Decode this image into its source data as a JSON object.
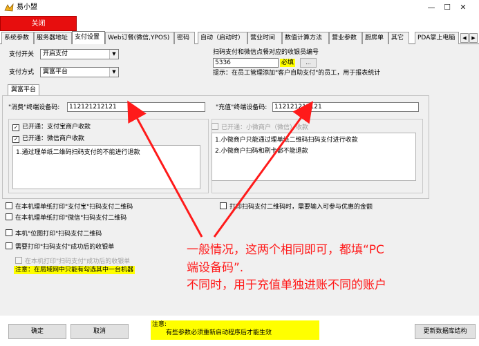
{
  "window": {
    "title": "易小盟",
    "minimize": "—",
    "maximize": "☐",
    "close": "✕"
  },
  "close_bar_label": "关闭",
  "tabs": [
    {
      "label": "系统参数"
    },
    {
      "label": "服务器地址"
    },
    {
      "label": "支付设置"
    },
    {
      "label": "Web订餐(微信,YPOS)"
    },
    {
      "label": "密码"
    },
    {
      "label": "自动（启动时）"
    },
    {
      "label": "营业时间"
    },
    {
      "label": "数值计算方法"
    },
    {
      "label": "营业参数"
    },
    {
      "label": "厨房单"
    },
    {
      "label": "其它"
    },
    {
      "label": "PDA掌上电脑"
    }
  ],
  "tab_scroll": {
    "left": "◀",
    "right": "▶"
  },
  "payment": {
    "switch_label": "支付开关",
    "switch_value": "开启支付",
    "method_label": "支付方式",
    "method_value": "翼富平台",
    "cashier_label": "扫码支付和微信点餐对应的收银员编号",
    "cashier_value": "5336",
    "required_badge": "必填",
    "browse_button": "...",
    "hint": "提示：在员工管理添加\"客户自助支付\"的员工，用于报表统计"
  },
  "platform_tab": "翼富平台",
  "terminal": {
    "consume_label": "\"消费\"终端设备码:",
    "consume_value": "112121212121",
    "recharge_label": "\"充值\"终端设备码:",
    "recharge_value": "112121212121"
  },
  "left_group": {
    "alipay_label": "已开通：支付宝商户收款",
    "wechat_label": "已开通：微信商户收款",
    "list_items": [
      "1.通过理单纸二维码扫码支付的不能进行退款"
    ]
  },
  "right_group": {
    "mini_label": "已开通：小微商户（微信）收款",
    "list_items": [
      "1.小微商户只能通过理单纸二维码扫码支付进行收款",
      "2.小微商户扫码和刷卡都不能退款"
    ]
  },
  "options": {
    "print_alipay": "在本机理单纸打印\"支付宝\"扫码支付二维码",
    "print_wechat": "在本机理单纸打印\"微信\"扫码支付二维码",
    "bitmap_print": "本机\"位图打印\"扫码支付二维码",
    "print_receipt": "需要打印\"扫码支付\"成功后的收银单",
    "print_receipt_local": "在本机打印\"扫码支付\"成功后的收银单",
    "lan_note": "注意：在局域网中只能有勾选其中一台机器",
    "print_qr_amount": "打印扫码支付二维码时，需要输入可参与优惠的金额"
  },
  "annotation": {
    "line1": "一般情况，这两个相同即可，都填“PC",
    "line2": "端设备码”.",
    "line3": "不同时，用于充值单独进账不同的账户"
  },
  "footer": {
    "ok": "确定",
    "cancel": "取消",
    "note_title": "注意:",
    "note_text": "有些参数必须重新启动程序后才能生效",
    "update_db": "更新数据库结构"
  },
  "colors": {
    "close_bar": "#e70e0e",
    "highlight": "#ffff00",
    "annotation": "#ff1a1a"
  }
}
